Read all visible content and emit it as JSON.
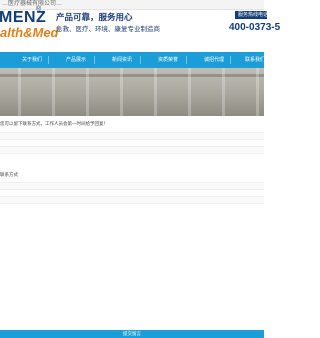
{
  "topbar": {
    "text": "…医疗器械有限公司…"
  },
  "header": {
    "logo_top": "MENZ",
    "logo_reg": "®",
    "logo_bottom": "alth&Med",
    "slogan_main": "产品可靠，服务用心",
    "slogan_sub": "急救、医疗、环境、康复专业制造商",
    "hotline_label": "服务热线电话",
    "hotline_number": "400-0373-5"
  },
  "nav": {
    "items": [
      "关于我们",
      "产品展示",
      "新闻资讯",
      "资质荣誉",
      "诚招代理",
      "联系我们"
    ]
  },
  "content": {
    "notice": "您可以留下联系方式，工作人员会第一时间给予回复！",
    "field_label": "联系方式",
    "submit_label": "提交留言"
  },
  "colors": {
    "brand_blue": "#123d78",
    "nav_blue": "#1b9ed8",
    "logo_orange": "#e0801a"
  }
}
